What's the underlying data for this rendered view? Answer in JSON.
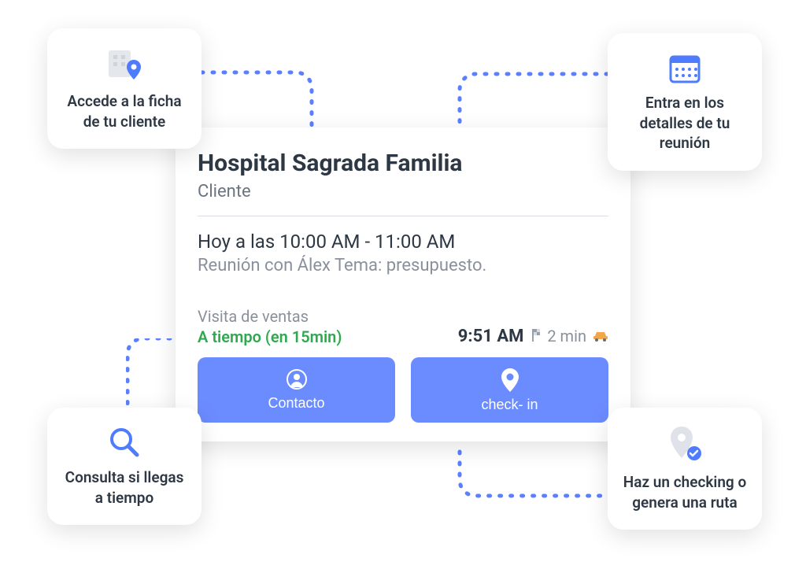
{
  "card": {
    "title": "Hospital Sagrada Familia",
    "subtitle": "Cliente",
    "timeRange": "Hoy a las 10:00 AM - 11:00 AM",
    "meetingNote": "Reunión con Álex Tema: presupuesto.",
    "visitType": "Visita de ventas",
    "onTime": "A tiempo (en 15min)",
    "currentTime": "9:51 AM",
    "travelTime": "2 min",
    "contactLabel": "Contacto",
    "checkinLabel": "check- in"
  },
  "annotations": {
    "topLeft": "Accede a la ficha de tu cliente",
    "topRight": "Entra en los detalles de tu reunión",
    "bottomLeft": "Consulta si llegas a tiempo",
    "bottomRight": "Haz un checking o genera una ruta"
  }
}
